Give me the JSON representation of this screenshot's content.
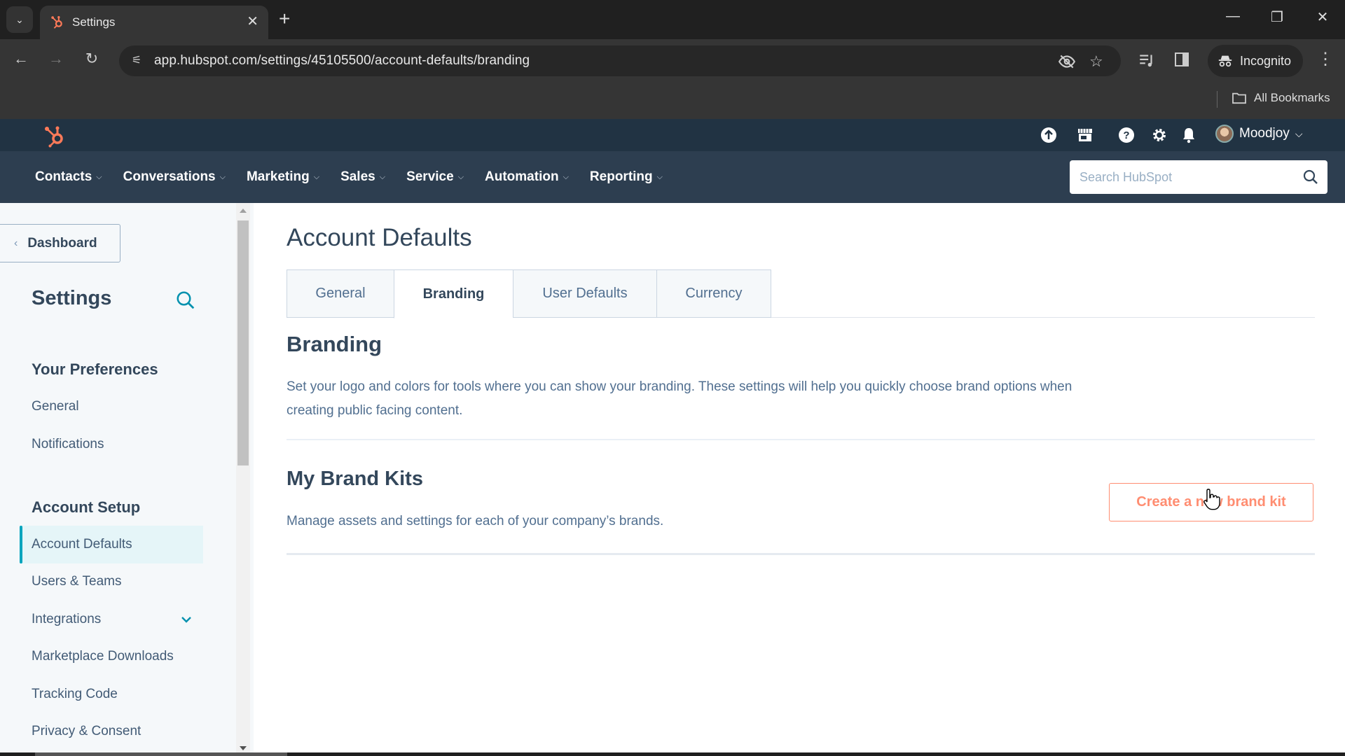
{
  "browser": {
    "tab_title": "Settings",
    "tab_close": "✕",
    "new_tab": "+",
    "url": "app.hubspot.com/settings/45105500/account-defaults/branding",
    "incognito_label": "Incognito",
    "bookmarks_label": "All Bookmarks",
    "window_controls": {
      "minimize": "—",
      "restore": "❐",
      "close": "✕"
    }
  },
  "hubspot": {
    "account_name": "Moodjoy",
    "nav": [
      {
        "label": "Contacts"
      },
      {
        "label": "Conversations"
      },
      {
        "label": "Marketing"
      },
      {
        "label": "Sales"
      },
      {
        "label": "Service"
      },
      {
        "label": "Automation"
      },
      {
        "label": "Reporting"
      }
    ],
    "search_placeholder": "Search HubSpot",
    "brand_color": "#ff7a59",
    "header_color": "#213343"
  },
  "sidebar": {
    "back_label": "Dashboard",
    "title": "Settings",
    "sections": [
      {
        "title": "Your Preferences",
        "items": [
          {
            "label": "General"
          },
          {
            "label": "Notifications"
          }
        ]
      },
      {
        "title": "Account Setup",
        "items": [
          {
            "label": "Account Defaults",
            "active": true
          },
          {
            "label": "Users & Teams"
          },
          {
            "label": "Integrations",
            "expandable": true
          },
          {
            "label": "Marketplace Downloads"
          },
          {
            "label": "Tracking Code"
          },
          {
            "label": "Privacy & Consent"
          }
        ]
      }
    ],
    "accent_color": "#00a4bd"
  },
  "main": {
    "page_title": "Account Defaults",
    "tabs": [
      {
        "label": "General"
      },
      {
        "label": "Branding",
        "active": true
      },
      {
        "label": "User Defaults"
      },
      {
        "label": "Currency"
      }
    ],
    "branding": {
      "heading": "Branding",
      "description_line1": "Set your logo and colors for tools where you can show your branding. These settings will help you quickly choose brand options when",
      "description_line2": "creating public facing content."
    },
    "brand_kits": {
      "heading": "My Brand Kits",
      "description": "Manage assets and settings for each of your company’s brands.",
      "create_button": "Create a new brand kit"
    }
  }
}
